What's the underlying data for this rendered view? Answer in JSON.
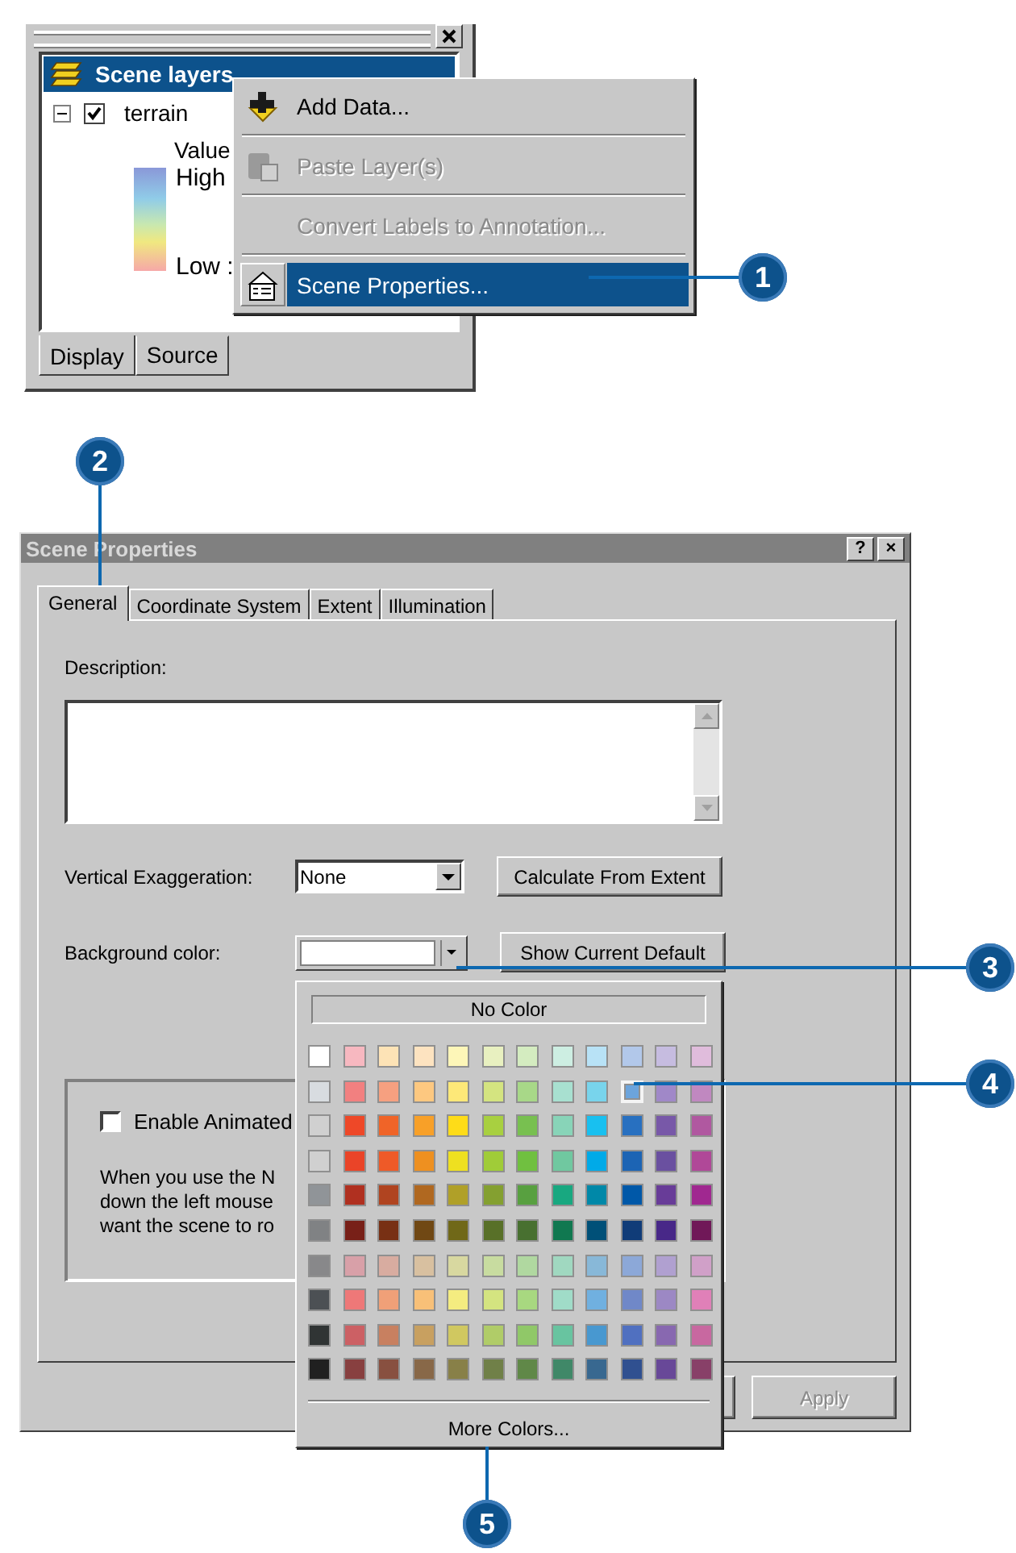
{
  "layers_panel": {
    "title": "Scene layers",
    "layer": {
      "name": "terrain",
      "checked": true,
      "expanded": true
    },
    "legend": {
      "field": "Value",
      "high": "High",
      "low": "Low :"
    },
    "tabs": [
      {
        "label": "Display",
        "selected": true
      },
      {
        "label": "Source",
        "selected": false
      }
    ]
  },
  "context_menu": {
    "items": [
      {
        "label": "Add Data...",
        "kind": "add",
        "disabled": false,
        "selected": false
      },
      {
        "label": "Paste Layer(s)",
        "kind": "paste",
        "disabled": true,
        "selected": false
      },
      {
        "label": "Convert Labels to Annotation...",
        "kind": "plain",
        "disabled": true,
        "selected": false
      },
      {
        "label": "Scene Properties...",
        "kind": "properties",
        "disabled": false,
        "selected": true
      }
    ]
  },
  "dialog": {
    "title": "Scene Properties",
    "title_buttons": [
      "?",
      "×"
    ],
    "tabs": [
      {
        "label": "General",
        "selected": true
      },
      {
        "label": "Coordinate System",
        "selected": false
      },
      {
        "label": "Extent",
        "selected": false
      },
      {
        "label": "Illumination",
        "selected": false
      }
    ],
    "description_label": "Description:",
    "vertical_exaggeration": {
      "label": "Vertical Exaggeration:",
      "value": "None"
    },
    "calculate_button": "Calculate From Extent",
    "background_color_label": "Background color:",
    "default_button": "Show Current Default",
    "animation": {
      "label": "Enable Animated",
      "checked": false,
      "text_lines": [
        "When you use the N",
        "down the left mouse",
        "want the scene to ro"
      ]
    },
    "apply_button": {
      "label": "Apply",
      "disabled": true
    }
  },
  "color_palette": {
    "no_color": "No Color",
    "more_colors": "More Colors...",
    "rows": [
      [
        {
          "color": "#ffffff",
          "selected": false
        },
        {
          "color": "#f7b8c0",
          "selected": false
        },
        {
          "color": "#fde3b6",
          "selected": false
        },
        {
          "color": "#fde3c0",
          "selected": false
        },
        {
          "color": "#fdf6b8",
          "selected": false
        },
        {
          "color": "#e8f0c0",
          "selected": false
        },
        {
          "color": "#d4ecc0",
          "selected": false
        },
        {
          "color": "#cdeee2",
          "selected": false
        },
        {
          "color": "#b8e2f6",
          "selected": false
        },
        {
          "color": "#b2c8ea",
          "selected": false
        },
        {
          "color": "#c6bce0",
          "selected": false
        },
        {
          "color": "#e0bcdc",
          "selected": false
        }
      ],
      [
        {
          "color": "#d8dce0",
          "selected": false
        },
        {
          "color": "#f28080",
          "selected": false
        },
        {
          "color": "#f6a080",
          "selected": false
        },
        {
          "color": "#fdc880",
          "selected": false
        },
        {
          "color": "#fde878",
          "selected": false
        },
        {
          "color": "#d4e480",
          "selected": false
        },
        {
          "color": "#a8d888",
          "selected": false
        },
        {
          "color": "#a8e0d0",
          "selected": false
        },
        {
          "color": "#78d4ec",
          "selected": false
        },
        {
          "color": "#6ca4dc",
          "selected": true
        },
        {
          "color": "#a088c8",
          "selected": false
        },
        {
          "color": "#c088c0",
          "selected": false
        }
      ],
      [
        {
          "color": "#d0d0d0",
          "selected": false
        },
        {
          "color": "#ee4828",
          "selected": false
        },
        {
          "color": "#f06428",
          "selected": false
        },
        {
          "color": "#f8a028",
          "selected": false
        },
        {
          "color": "#fedc18",
          "selected": false
        },
        {
          "color": "#a8d040",
          "selected": false
        },
        {
          "color": "#78c050",
          "selected": false
        },
        {
          "color": "#88d4b8",
          "selected": false
        },
        {
          "color": "#18c0f0",
          "selected": false
        },
        {
          "color": "#2870c0",
          "selected": false
        },
        {
          "color": "#7858a8",
          "selected": false
        },
        {
          "color": "#b058a0",
          "selected": false
        }
      ],
      [
        {
          "color": "#d0d0d0",
          "selected": false
        },
        {
          "color": "#ea4428",
          "selected": false
        },
        {
          "color": "#ee5a28",
          "selected": false
        },
        {
          "color": "#ee9020",
          "selected": false
        },
        {
          "color": "#eee020",
          "selected": false
        },
        {
          "color": "#a0cc38",
          "selected": false
        },
        {
          "color": "#70c040",
          "selected": false
        },
        {
          "color": "#70c8a0",
          "selected": false
        },
        {
          "color": "#00aae8",
          "selected": false
        },
        {
          "color": "#1c64b4",
          "selected": false
        },
        {
          "color": "#6a50a0",
          "selected": false
        },
        {
          "color": "#b04898",
          "selected": false
        }
      ],
      [
        {
          "color": "#909498",
          "selected": false
        },
        {
          "color": "#b03020",
          "selected": false
        },
        {
          "color": "#b04420",
          "selected": false
        },
        {
          "color": "#b06820",
          "selected": false
        },
        {
          "color": "#b0a028",
          "selected": false
        },
        {
          "color": "#84a030",
          "selected": false
        },
        {
          "color": "#58a040",
          "selected": false
        },
        {
          "color": "#18a880",
          "selected": false
        },
        {
          "color": "#0088a8",
          "selected": false
        },
        {
          "color": "#0058a8",
          "selected": false
        },
        {
          "color": "#683c98",
          "selected": false
        },
        {
          "color": "#a02890",
          "selected": false
        }
      ],
      [
        {
          "color": "#808284",
          "selected": false
        },
        {
          "color": "#782018",
          "selected": false
        },
        {
          "color": "#783014",
          "selected": false
        },
        {
          "color": "#704814",
          "selected": false
        },
        {
          "color": "#706818",
          "selected": false
        },
        {
          "color": "#587028",
          "selected": false
        },
        {
          "color": "#487030",
          "selected": false
        },
        {
          "color": "#107850",
          "selected": false
        },
        {
          "color": "#005078",
          "selected": false
        },
        {
          "color": "#103c78",
          "selected": false
        },
        {
          "color": "#482888",
          "selected": false
        },
        {
          "color": "#701858",
          "selected": false
        }
      ],
      [
        {
          "color": "#88888a",
          "selected": false
        },
        {
          "color": "#d8a0a8",
          "selected": false
        },
        {
          "color": "#d8aca0",
          "selected": false
        },
        {
          "color": "#d8c0a0",
          "selected": false
        },
        {
          "color": "#d8d8a0",
          "selected": false
        },
        {
          "color": "#c8dca0",
          "selected": false
        },
        {
          "color": "#b0d8a0",
          "selected": false
        },
        {
          "color": "#a0d8c0",
          "selected": false
        },
        {
          "color": "#88b8d8",
          "selected": false
        },
        {
          "color": "#8ca8d8",
          "selected": false
        },
        {
          "color": "#b0a0d0",
          "selected": false
        },
        {
          "color": "#d0a0c8",
          "selected": false
        }
      ],
      [
        {
          "color": "#4c5054",
          "selected": false
        },
        {
          "color": "#ee7878",
          "selected": false
        },
        {
          "color": "#f0a078",
          "selected": false
        },
        {
          "color": "#f8c078",
          "selected": false
        },
        {
          "color": "#f4ec80",
          "selected": false
        },
        {
          "color": "#d4e480",
          "selected": false
        },
        {
          "color": "#a8d880",
          "selected": false
        },
        {
          "color": "#a0dcc8",
          "selected": false
        },
        {
          "color": "#70b0e0",
          "selected": false
        },
        {
          "color": "#7088c8",
          "selected": false
        },
        {
          "color": "#9c88c4",
          "selected": false
        },
        {
          "color": "#e080b8",
          "selected": false
        }
      ],
      [
        {
          "color": "#303434",
          "selected": false
        },
        {
          "color": "#cc6064",
          "selected": false
        },
        {
          "color": "#c88060",
          "selected": false
        },
        {
          "color": "#c8a060",
          "selected": false
        },
        {
          "color": "#d0c860",
          "selected": false
        },
        {
          "color": "#b0cc68",
          "selected": false
        },
        {
          "color": "#90c868",
          "selected": false
        },
        {
          "color": "#68c4a0",
          "selected": false
        },
        {
          "color": "#4898d0",
          "selected": false
        },
        {
          "color": "#5070c0",
          "selected": false
        },
        {
          "color": "#8868b0",
          "selected": false
        },
        {
          "color": "#c868a0",
          "selected": false
        }
      ],
      [
        {
          "color": "#202020",
          "selected": false
        },
        {
          "color": "#884040",
          "selected": false
        },
        {
          "color": "#885040",
          "selected": false
        },
        {
          "color": "#886848",
          "selected": false
        },
        {
          "color": "#888048",
          "selected": false
        },
        {
          "color": "#708048",
          "selected": false
        },
        {
          "color": "#608848",
          "selected": false
        },
        {
          "color": "#408868",
          "selected": false
        },
        {
          "color": "#386890",
          "selected": false
        },
        {
          "color": "#305090",
          "selected": false
        },
        {
          "color": "#684898",
          "selected": false
        },
        {
          "color": "#884068",
          "selected": false
        }
      ]
    ]
  },
  "callouts": [
    "1",
    "2",
    "3",
    "4",
    "5"
  ]
}
